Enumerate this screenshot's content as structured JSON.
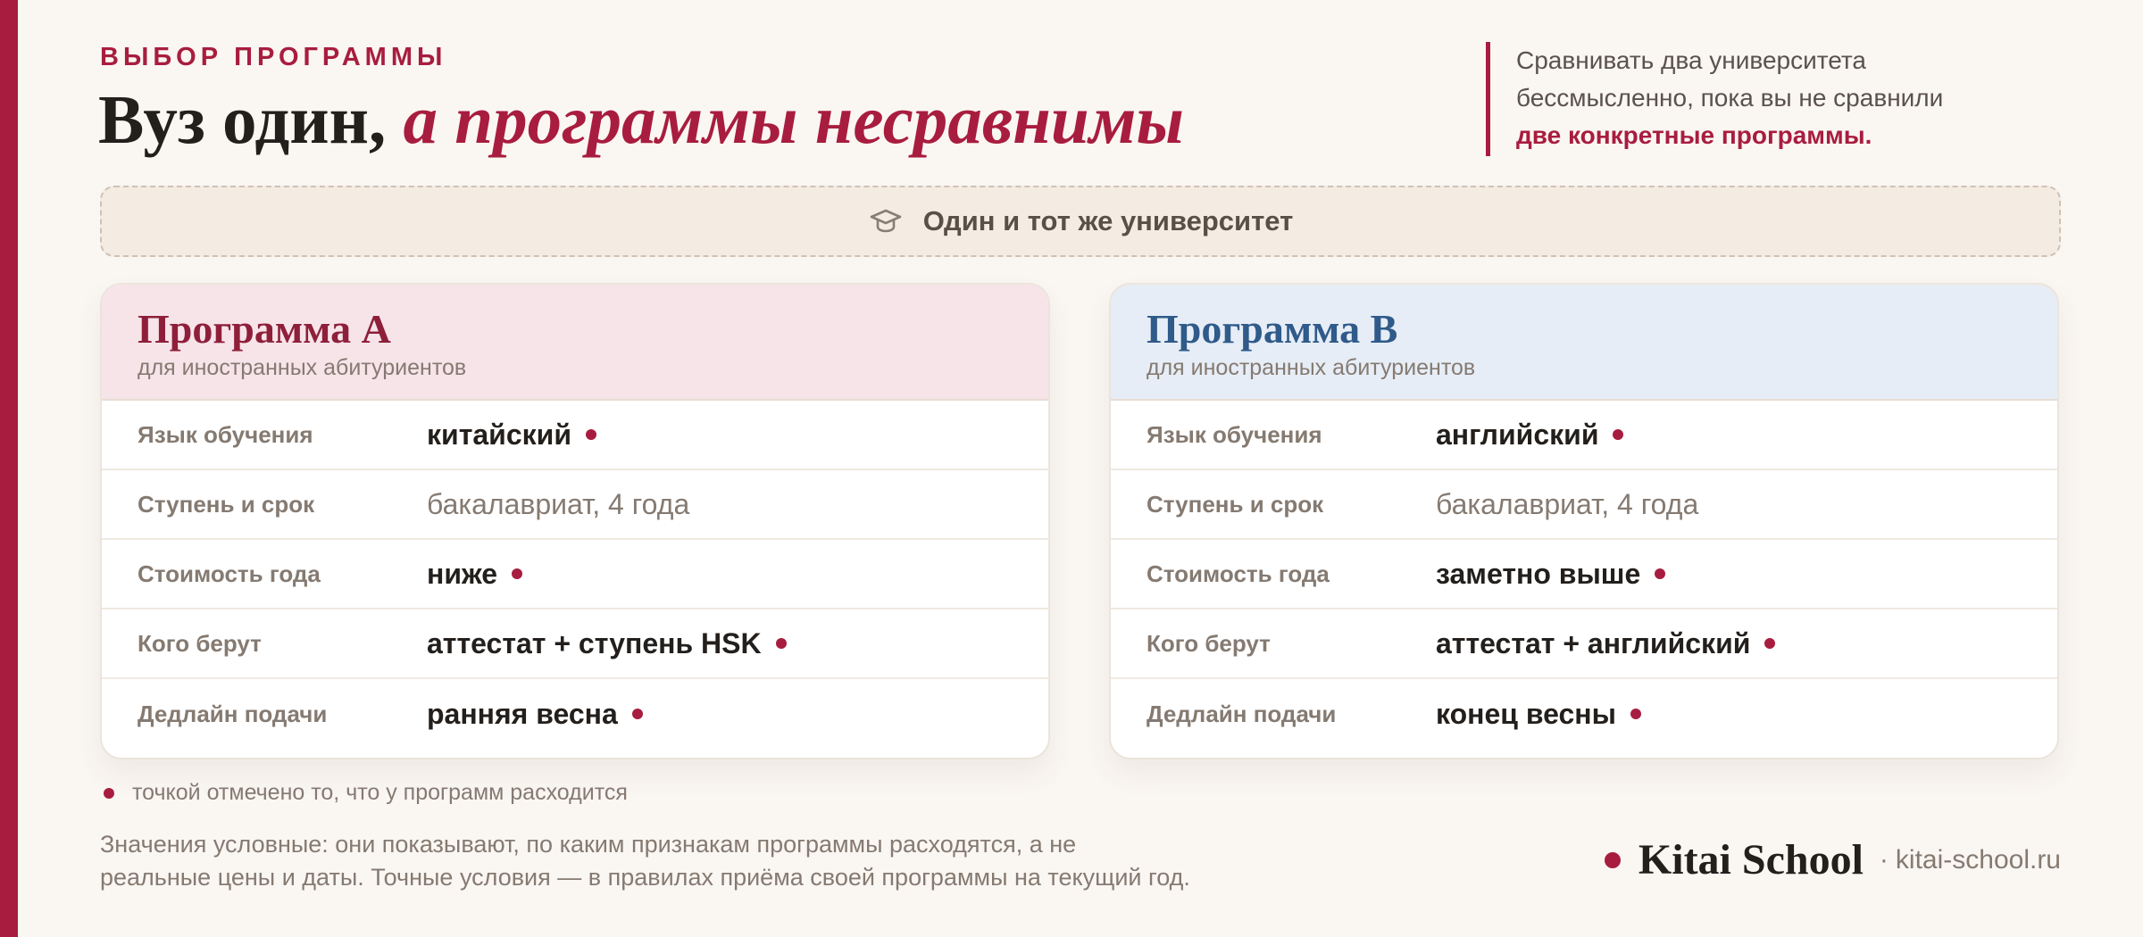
{
  "header": {
    "eyebrow": "ВЫБОР ПРОГРАММЫ",
    "title_plain": "Вуз один, ",
    "title_accent": "а программы несравнимы"
  },
  "side_note": {
    "line1": "Сравнивать два университета",
    "line2": "бессмысленно, пока вы не сравнили",
    "line3": "две конкретные программы."
  },
  "banner": {
    "icon": "graduation-cap-icon",
    "text": "Один и тот же университет"
  },
  "cards": [
    {
      "title": "Программа A",
      "subtitle": "для иностранных абитуриентов",
      "rows": [
        {
          "label": "Язык обучения",
          "value": "китайский",
          "differs": true
        },
        {
          "label": "Ступень и срок",
          "value": "бакалавриат, 4 года",
          "differs": false
        },
        {
          "label": "Стоимость года",
          "value": "ниже",
          "differs": true
        },
        {
          "label": "Кого берут",
          "value": "аттестат + ступень HSK",
          "differs": true
        },
        {
          "label": "Дедлайн подачи",
          "value": "ранняя весна",
          "differs": true
        }
      ]
    },
    {
      "title": "Программа B",
      "subtitle": "для иностранных абитуриентов",
      "rows": [
        {
          "label": "Язык обучения",
          "value": "английский",
          "differs": true
        },
        {
          "label": "Ступень и срок",
          "value": "бакалавриат, 4 года",
          "differs": false
        },
        {
          "label": "Стоимость года",
          "value": "заметно выше",
          "differs": true
        },
        {
          "label": "Кого берут",
          "value": "аттестат + английский",
          "differs": true
        },
        {
          "label": "Дедлайн подачи",
          "value": "конец весны",
          "differs": true
        }
      ]
    }
  ],
  "legend": {
    "text": "точкой отмечено то, что у программ расходится"
  },
  "disclaimer": {
    "line1": "Значения условные: они показывают, по каким признакам программы расходятся, а не",
    "line2": "реальные цены и даты. Точные условия — в правилах приёма своей программы на текущий год."
  },
  "brand": {
    "name": "Kitai School",
    "separator": "·",
    "url": "kitai-school.ru"
  },
  "colors": {
    "accent": "#a81d3f",
    "program_a": "#8e1f3a",
    "program_b": "#2f5a8a",
    "background": "#faf6f2"
  }
}
